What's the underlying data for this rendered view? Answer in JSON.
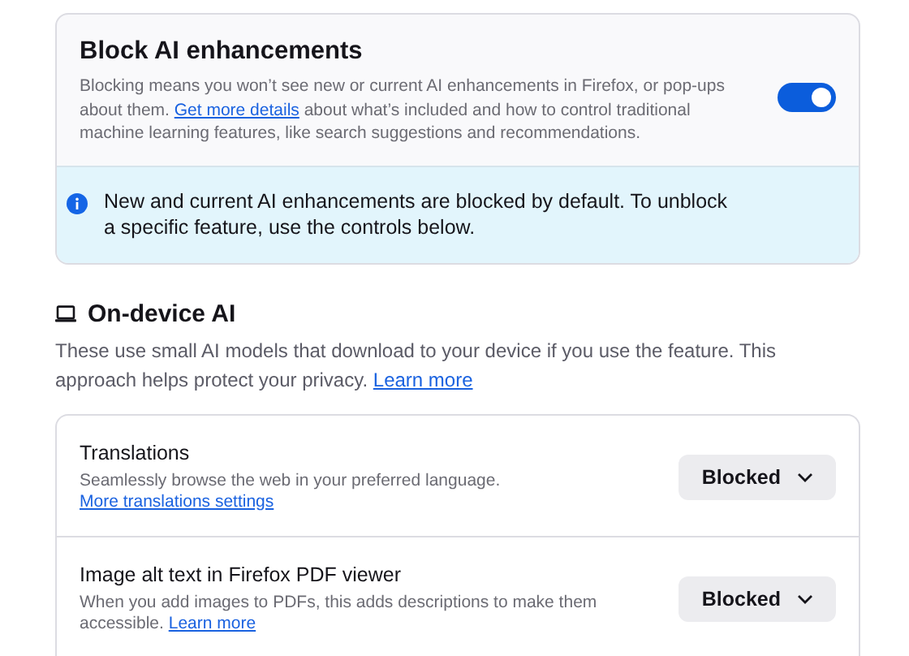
{
  "block_card": {
    "title": "Block AI enhancements",
    "description": {
      "before": "Blocking means you won’t see new or current AI enhancements in Firefox, or pop-ups about them. ",
      "link": "Get more details",
      "after": " about what’s included and how to control traditional machine learning features, like search suggestions and recommendations."
    },
    "toggle": {
      "on": true
    },
    "info": "New and current AI enhancements are blocked by default. To unblock a specific feature, use the controls below."
  },
  "section": {
    "title": "On-device AI",
    "description": {
      "before": "These use small AI models that download to your device if you use the feature. This approach helps protect your privacy. ",
      "link": "Learn more"
    }
  },
  "features": [
    {
      "name": "Translations",
      "description": {
        "before": "Seamlessly browse the web in your preferred language.",
        "link": "More translations settings",
        "link_on_new_line": true
      },
      "status": "Blocked"
    },
    {
      "name": "Image alt text in Firefox PDF viewer",
      "description": {
        "before": "When you add images to PDFs, this adds descriptions to make them accessible. ",
        "link": "Learn more",
        "link_on_new_line": false
      },
      "status": "Blocked"
    }
  ]
}
